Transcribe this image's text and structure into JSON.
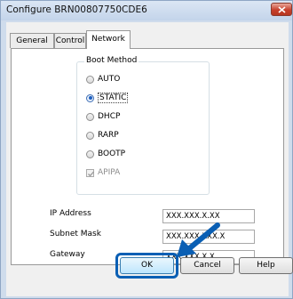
{
  "window": {
    "title": "Configure BRN00807750CDE6",
    "close_icon": "close-icon"
  },
  "tabs": [
    {
      "label": "General",
      "selected": false
    },
    {
      "label": "Control",
      "selected": false
    },
    {
      "label": "Network",
      "selected": true
    }
  ],
  "boot_method": {
    "label": "Boot Method",
    "options": [
      {
        "label": "AUTO",
        "selected": false
      },
      {
        "label": "STATIC",
        "selected": true
      },
      {
        "label": "DHCP",
        "selected": false
      },
      {
        "label": "RARP",
        "selected": false
      },
      {
        "label": "BOOTP",
        "selected": false
      }
    ],
    "apipa": {
      "label": "APIPA",
      "checked": true,
      "enabled": false
    }
  },
  "fields": {
    "ip_address": {
      "label": "IP Address",
      "value": "XXX.XXX.X.XX"
    },
    "subnet_mask": {
      "label": "Subnet Mask",
      "value": "XXX.XXX.XXX.X"
    },
    "gateway": {
      "label": "Gateway",
      "value": "XXX.XXX.X.X"
    }
  },
  "buttons": {
    "ok": "OK",
    "cancel": "Cancel",
    "help": "Help"
  },
  "colors": {
    "highlight": "#0a5fb4",
    "radio_selected": "#1f5fbf"
  }
}
